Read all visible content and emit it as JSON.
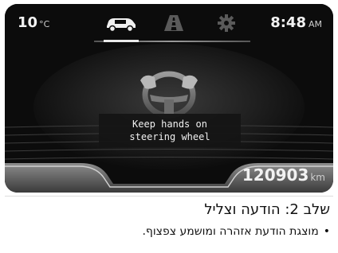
{
  "status_bar": {
    "temperature": "10",
    "temperature_unit": "°C",
    "time": "8:48",
    "time_suffix": "AM"
  },
  "tabs": [
    {
      "icon": "car-icon",
      "active": true
    },
    {
      "icon": "lane-road-icon",
      "active": false
    },
    {
      "icon": "gear-icon",
      "active": false
    }
  ],
  "warning": {
    "icon": "hands-on-steering-wheel-icon",
    "line1": "Keep hands on",
    "line2": "steering wheel"
  },
  "odometer": {
    "value": "120903",
    "unit": "km"
  },
  "caption": {
    "step_title": "שלב 2: הודעה וצליל",
    "bullet": "מוצגת הודעת אזהרה ומושמע צפצוף."
  },
  "colors": {
    "screen_bg": "#0c0c0c",
    "text": "#f2f2f2"
  }
}
